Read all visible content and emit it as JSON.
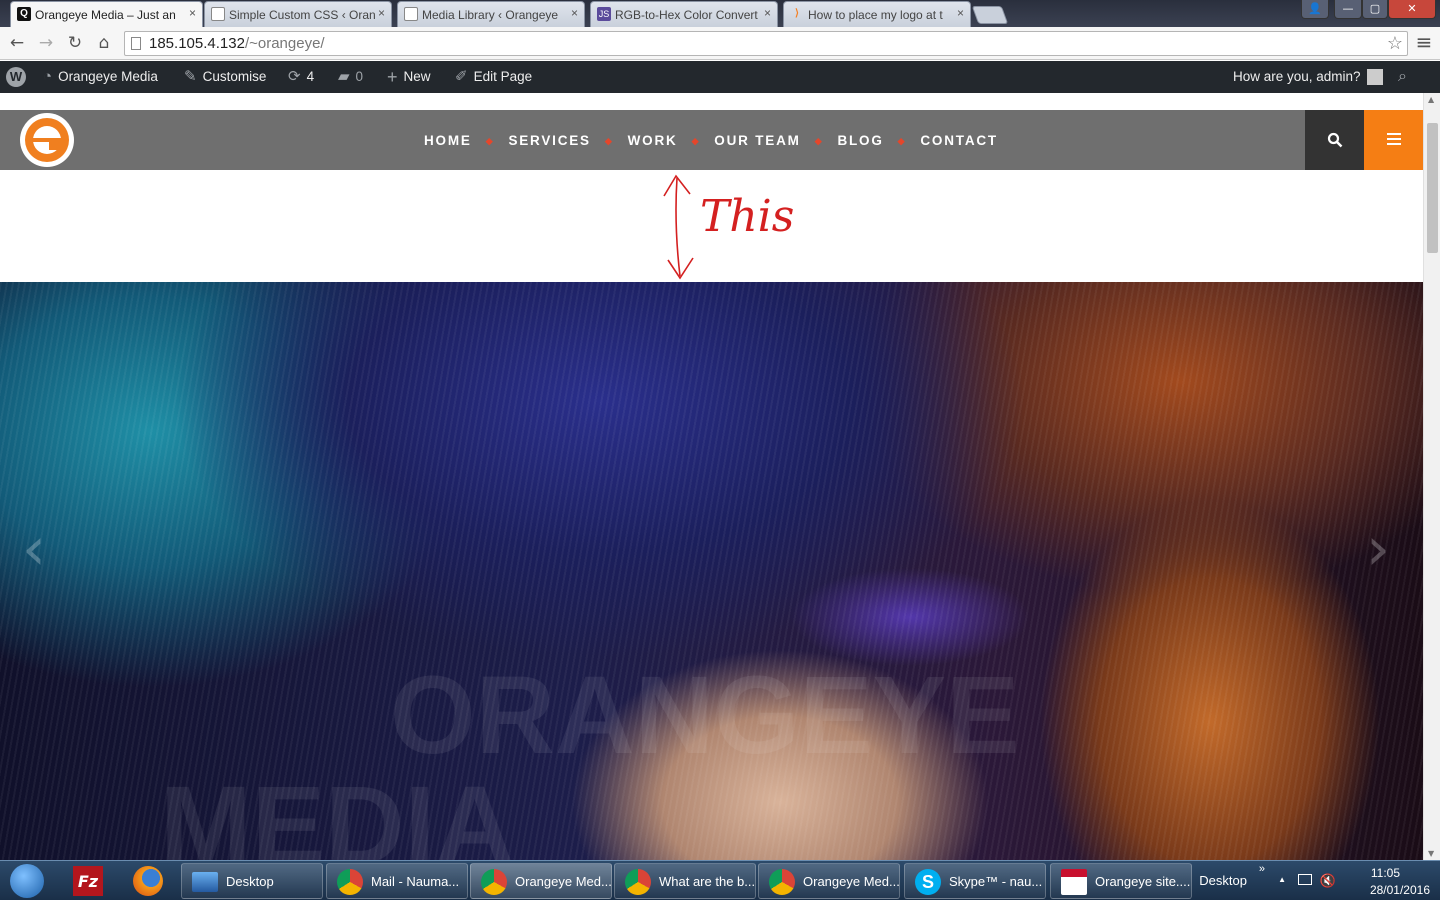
{
  "browser": {
    "tabs": [
      {
        "title": "Orangeye Media – Just an",
        "active": true,
        "favicon": "q-icon"
      },
      {
        "title": "Simple Custom CSS ‹ Oran",
        "active": false,
        "favicon": "page-icon"
      },
      {
        "title": "Media Library ‹ Orangeye",
        "active": false,
        "favicon": "page-icon"
      },
      {
        "title": "RGB-to-Hex Color Convert",
        "active": false,
        "favicon": "js-icon"
      },
      {
        "title": "How to place my logo at t",
        "active": false,
        "favicon": "stack-icon"
      }
    ],
    "tab_close": "×",
    "url_host": "185.105.4.132",
    "url_path": "/~orangeye/",
    "nav": {
      "back": "←",
      "forward": "→",
      "reload": "↻",
      "home": "⌂",
      "star": "☆",
      "menu": "≡"
    },
    "window": {
      "user": "👤",
      "min": "—",
      "max": "▢",
      "close": "✕"
    }
  },
  "adminbar": {
    "wp_logo": "W",
    "site_name": "Orangeye Media",
    "customise": "Customise",
    "updates_count": "4",
    "comments_count": "0",
    "new_label": "New",
    "edit_page": "Edit Page",
    "greeting": "How are you, admin?"
  },
  "site": {
    "nav_items": [
      "HOME",
      "SERVICES",
      "WORK",
      "OUR TEAM",
      "BLOG",
      "CONTACT"
    ],
    "separator": "◆",
    "search_icon": "search-icon",
    "menu_icon": "hamburger-icon",
    "accent": "#f57e14",
    "header_bg": "#6f6f6f"
  },
  "annotation": {
    "text": "This",
    "color": "#d42020"
  },
  "hero": {
    "watermark_1": "ORANGEYE",
    "watermark_2": "MEDIA",
    "prev_arrow": "‹",
    "next_arrow": "›"
  },
  "taskbar": {
    "items": [
      {
        "label": "Desktop",
        "icon": "desktop-icon"
      },
      {
        "label": "Mail - Nauma...",
        "icon": "chrome-icon"
      },
      {
        "label": "Orangeye Med...",
        "icon": "chrome-icon"
      },
      {
        "label": "What are the b...",
        "icon": "chrome-icon"
      },
      {
        "label": "Orangeye Med...",
        "icon": "chrome-icon"
      },
      {
        "label": "Skype™ - nau...",
        "icon": "skype-icon"
      },
      {
        "label": "Orangeye site....",
        "icon": "pdf-icon"
      }
    ],
    "desktop_toolbar": "Desktop",
    "chevron": "»",
    "tray_up": "▲",
    "time": "11:05",
    "date": "28/01/2016"
  }
}
